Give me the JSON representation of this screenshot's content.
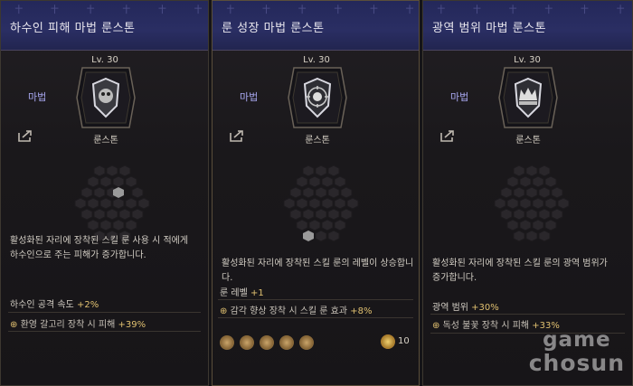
{
  "panels": [
    {
      "title": "하수인 피해 마법 룬스톤",
      "level": "Lv. 30",
      "category": "마법",
      "rune_label": "룬스톤",
      "description": [
        "활성화된 자리에 장착된 스킬 룬 사용 시 적에게",
        "하수인으로 주는 피해가 증가합니다."
      ],
      "stat_name": "하수인 공격 속도",
      "stat_value": "+2%",
      "sub_name": "환영 갈고리 장착 시 피해",
      "sub_value": "+39%"
    },
    {
      "title": "룬 성장 마법 룬스톤",
      "level": "Lv. 30",
      "category": "마법",
      "rune_label": "룬스톤",
      "description": [
        "활성화된 자리에 장착된 스킬 룬의 레벨이 상승합니다."
      ],
      "stat_name": "룬 레벨",
      "stat_value": "+1",
      "sub_name": "감각 향상 장착 시 스킬 룬 효과",
      "sub_value": "+8%",
      "coin_value": "10"
    },
    {
      "title": "광역 범위 마법 룬스톤",
      "level": "Lv. 30",
      "category": "마법",
      "rune_label": "룬스톤",
      "description": [
        "활성화된 자리에 장착된 스킬 룬의 광역 범위가",
        "증가합니다."
      ],
      "stat_name": "광역 범위",
      "stat_value": "+30%",
      "sub_name": "독성 불꽃 장착 시 피해",
      "sub_value": "+33%"
    }
  ],
  "watermark": {
    "line1": "game",
    "line2": "chosun"
  },
  "colors": {
    "header": "#2a2e63",
    "accent": "#e0c070",
    "category": "#a8a8f0"
  },
  "icons": [
    "share-icon",
    "rune-shield-icon",
    "rune-orb-icon",
    "rune-crown-icon",
    "gold-coin-icon"
  ]
}
